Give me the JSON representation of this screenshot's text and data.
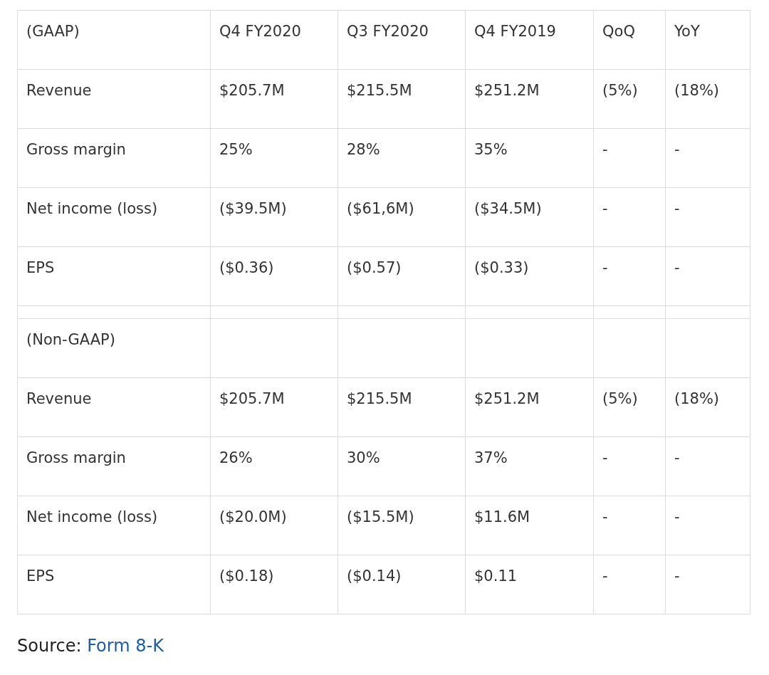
{
  "table": {
    "columns": [
      "(GAAP)",
      "Q4 FY2020",
      "Q3 FY2020",
      "Q4 FY2019",
      "QoQ",
      "YoY"
    ],
    "rows": [
      {
        "kind": "data",
        "cells": [
          "Revenue",
          "$205.7M",
          "$215.5M",
          "$251.2M",
          "(5%)",
          "(18%)"
        ]
      },
      {
        "kind": "data",
        "cells": [
          "Gross margin",
          "25%",
          "28%",
          "35%",
          "-",
          "-"
        ]
      },
      {
        "kind": "data",
        "cells": [
          "Net income (loss)",
          "($39.5M)",
          "($61,6M)",
          "($34.5M)",
          "-",
          "-"
        ]
      },
      {
        "kind": "data",
        "cells": [
          "EPS",
          "($0.36)",
          "($0.57)",
          "($0.33)",
          "-",
          "-"
        ]
      },
      {
        "kind": "spacer"
      },
      {
        "kind": "section",
        "label": "(Non-GAAP)"
      },
      {
        "kind": "data",
        "cells": [
          "Revenue",
          "$205.7M",
          "$215.5M",
          "$251.2M",
          "(5%)",
          "(18%)"
        ]
      },
      {
        "kind": "data",
        "cells": [
          "Gross margin",
          "26%",
          "30%",
          "37%",
          "-",
          "-"
        ]
      },
      {
        "kind": "data",
        "cells": [
          "Net income (loss)",
          "($20.0M)",
          "($15.5M)",
          "$11.6M",
          "-",
          "-"
        ]
      },
      {
        "kind": "data",
        "cells": [
          "EPS",
          "($0.18)",
          "($0.14)",
          "$0.11",
          "-",
          "-"
        ]
      }
    ]
  },
  "source": {
    "label": "Source:",
    "link": "Form 8-K"
  }
}
